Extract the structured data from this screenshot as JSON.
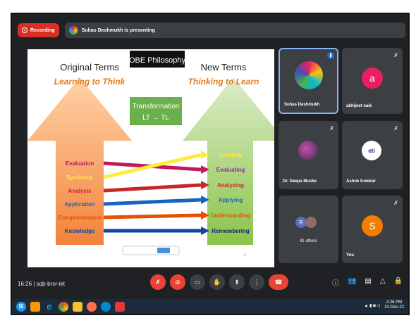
{
  "topbar": {
    "recording_label": "Recording",
    "presenting_text": "Suhas Deshmukh is presenting"
  },
  "slide": {
    "title": "OBE Philosophy",
    "left_heading": "Original Terms",
    "left_sub": "Learning to Think",
    "right_heading": "New Terms",
    "right_sub": "Thinking to Learn",
    "transform_line1": "Transformation",
    "transform_line2": "LT → TL",
    "left_terms": [
      {
        "label": "Evaluation",
        "color": "#c2185b"
      },
      {
        "label": "Synthesis",
        "color": "#ffeb3b"
      },
      {
        "label": "Analysis",
        "color": "#c62828"
      },
      {
        "label": "Application",
        "color": "#1565c0"
      },
      {
        "label": "Comprehension",
        "color": "#e65100"
      },
      {
        "label": "Knowledge",
        "color": "#0d47a1"
      }
    ],
    "right_terms": [
      {
        "label": "Creating",
        "color": "#ffeb3b"
      },
      {
        "label": "Evaluating",
        "color": "#8e24aa"
      },
      {
        "label": "Analyzing",
        "color": "#c62828"
      },
      {
        "label": "Applying",
        "color": "#1565c0"
      },
      {
        "label": "Understanding",
        "color": "#e65100"
      },
      {
        "label": "Remembering",
        "color": "#1a237e"
      }
    ],
    "page_number": "3"
  },
  "participants": [
    {
      "name": "Suhas Deshmukh",
      "initial": "",
      "color": "#fafafa"
    },
    {
      "name": "abhijeet naik",
      "initial": "a",
      "color": "#e91e63"
    },
    {
      "name": "Dr. Deepa Muske",
      "initial": "",
      "color": "#4a4a6a"
    },
    {
      "name": "Ashok Kolekar",
      "initial": "",
      "color": "#ffffff"
    },
    {
      "name": "41 others",
      "initial": "R",
      "color": "#5c6bc0"
    },
    {
      "name": "You",
      "initial": "S",
      "color": "#f57c00"
    }
  ],
  "bottombar": {
    "time": "16:26",
    "separator": "|",
    "meeting_code": "sqb-brsr-iet"
  },
  "tray": {
    "time": "4:26 PM",
    "date": "10-Dec-22"
  }
}
